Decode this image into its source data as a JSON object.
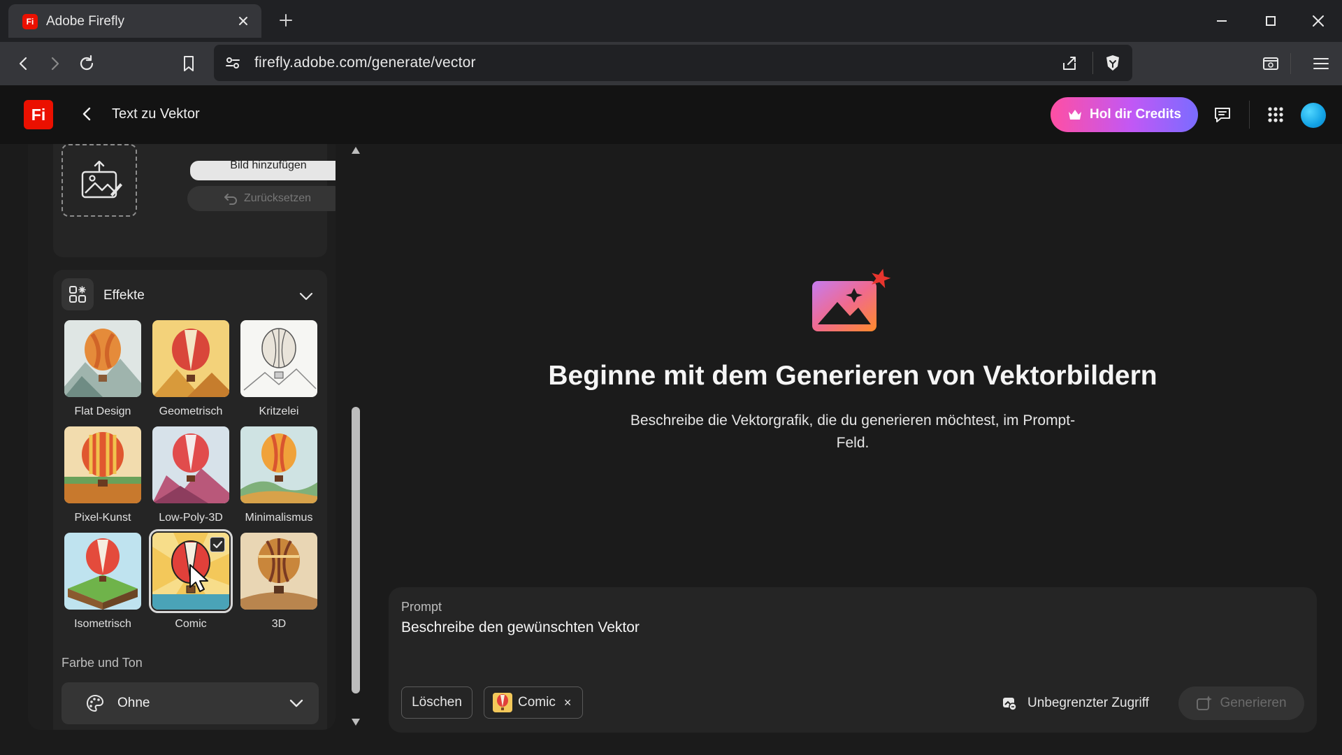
{
  "browser": {
    "tab_title": "Adobe Firefly",
    "favicon_text": "Fi",
    "url": "firefly.adobe.com/generate/vector"
  },
  "app": {
    "logo_text": "Fi",
    "page_title": "Text zu Vektor",
    "credits_label": "Hol dir Credits"
  },
  "sidebar": {
    "upload": {
      "add_image_label": "Bild hinzufügen",
      "reset_label": "Zurücksetzen"
    },
    "effects": {
      "title": "Effekte",
      "items": [
        {
          "label": "Flat Design",
          "selected": false
        },
        {
          "label": "Geometrisch",
          "selected": false
        },
        {
          "label": "Kritzelei",
          "selected": false
        },
        {
          "label": "Pixel-Kunst",
          "selected": false
        },
        {
          "label": "Low-Poly-3D",
          "selected": false
        },
        {
          "label": "Minimalismus",
          "selected": false
        },
        {
          "label": "Isometrisch",
          "selected": false
        },
        {
          "label": "Comic",
          "selected": true
        },
        {
          "label": "3D",
          "selected": false
        }
      ]
    },
    "color_tone": {
      "label": "Farbe und Ton",
      "value": "Ohne"
    }
  },
  "hero": {
    "title": "Beginne mit dem Generieren von Vektorbildern",
    "subtitle": "Beschreibe die Vektorgrafik, die du generieren möchtest, im Prompt-Feld."
  },
  "prompt": {
    "label": "Prompt",
    "placeholder": "Beschreibe den gewünschten Vektor",
    "clear_label": "Löschen",
    "chip_label": "Comic",
    "chip_remove": "×",
    "access_label": "Unbegrenzter Zugriff",
    "generate_label": "Generieren"
  },
  "colors": {
    "brand_red": "#eb1000",
    "credits_gradient_start": "#ff4fa3",
    "credits_gradient_end": "#7a6cff"
  }
}
